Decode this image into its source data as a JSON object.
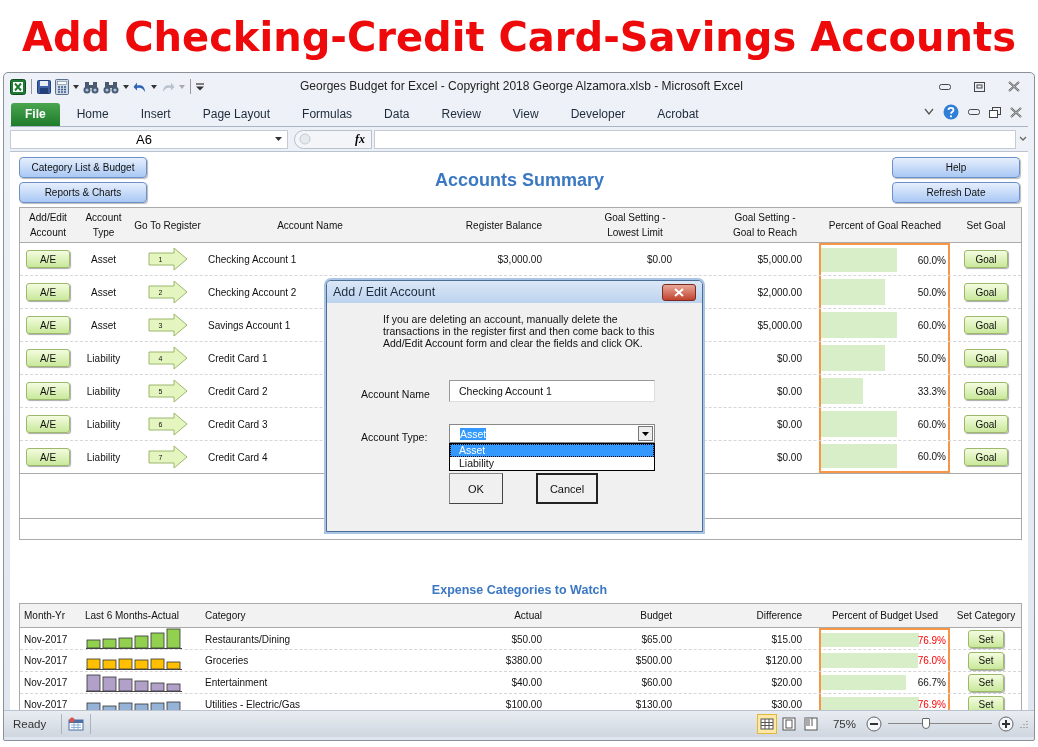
{
  "banner": {
    "title": "Add Checking-Credit Card-Savings Accounts"
  },
  "window": {
    "title": "Georges Budget for Excel - Copyright 2018 George Alzamora.xlsb  -  Microsoft Excel"
  },
  "ribbon": {
    "tabs": [
      {
        "label": "File",
        "kind": "file",
        "selected": false
      },
      {
        "label": "Home",
        "kind": "tab",
        "selected": false
      },
      {
        "label": "Insert",
        "kind": "tab",
        "selected": false
      },
      {
        "label": "Page Layout",
        "kind": "tab",
        "selected": false
      },
      {
        "label": "Formulas",
        "kind": "tab",
        "selected": false
      },
      {
        "label": "Data",
        "kind": "tab",
        "selected": false
      },
      {
        "label": "Review",
        "kind": "tab",
        "selected": false
      },
      {
        "label": "View",
        "kind": "tab",
        "selected": false
      },
      {
        "label": "Developer",
        "kind": "tab",
        "selected": false
      },
      {
        "label": "Acrobat",
        "kind": "tab",
        "selected": false
      }
    ]
  },
  "formula_bar": {
    "name_box": "A6",
    "function_label": "fx"
  },
  "sheet": {
    "left_buttons": [
      "Category List & Budget",
      "Reports & Charts"
    ],
    "title": "Accounts Summary",
    "right_buttons": [
      "Help",
      "Refresh Date"
    ],
    "accounts": {
      "columns": [
        "Add/Edit Account",
        "Account Type",
        "Go To Register",
        "Account Name",
        "Register Balance",
        "Goal Setting - Lowest Limit",
        "Goal Setting - Goal to Reach",
        "Percent of Goal Reached",
        "Set Goal"
      ],
      "rows": [
        {
          "edit_button": "A/E",
          "type": "Asset",
          "register_button": "1",
          "name": "Checking Account 1",
          "register_balance": "$3,000.00",
          "lowest_limit": "$0.00",
          "goal": "$5,000.00",
          "level": 0.6,
          "percent": "60.0%",
          "goal_button": "Goal"
        },
        {
          "edit_button": "A/E",
          "type": "Asset",
          "register_button": "2",
          "name": "Checking Account 2",
          "goal": "$2,000.00",
          "level": 0.5,
          "percent": "50.0%",
          "goal_button": "Goal"
        },
        {
          "edit_button": "A/E",
          "type": "Asset",
          "register_button": "3",
          "name": "Savings Account 1",
          "goal": "$5,000.00",
          "level": 0.6,
          "percent": "60.0%",
          "goal_button": "Goal"
        },
        {
          "edit_button": "A/E",
          "type": "Liability",
          "register_button": "4",
          "name": "Credit Card 1",
          "goal": "$0.00",
          "level": 0.5,
          "percent": "50.0%",
          "goal_button": "Goal"
        },
        {
          "edit_button": "A/E",
          "type": "Liability",
          "register_button": "5",
          "name": "Credit Card 2",
          "goal": "$0.00",
          "level": 0.333,
          "percent": "33.3%",
          "goal_button": "Goal"
        },
        {
          "edit_button": "A/E",
          "type": "Liability",
          "register_button": "6",
          "name": "Credit Card 3",
          "goal": "$0.00",
          "level": 0.6,
          "percent": "60.0%",
          "goal_button": "Goal"
        },
        {
          "edit_button": "A/E",
          "type": "Liability",
          "register_button": "7",
          "name": "Credit Card 4",
          "goal": "$0.00",
          "level": 0.6,
          "percent": "60.0%",
          "goal_button": "Goal"
        }
      ]
    },
    "expenses": {
      "title": "Expense Categories to Watch",
      "columns": [
        "Month-Yr",
        "Last 6 Months-Actual",
        "Category",
        "Actual",
        "Budget",
        "Difference",
        "Percent of Budget Used",
        "Set Category"
      ],
      "rows": [
        {
          "month": "Nov-2017",
          "color": "#92d050",
          "category": "Restaurants/Dining",
          "actual": "$50.00",
          "budget": "$65.00",
          "difference": "$15.00",
          "level": 0.769,
          "percent": "76.9%",
          "over": true,
          "button": "Set"
        },
        {
          "month": "Nov-2017",
          "color": "#ffc000",
          "category": "Groceries",
          "actual": "$380.00",
          "budget": "$500.00",
          "difference": "$120.00",
          "level": 0.76,
          "percent": "76.0%",
          "over": true,
          "button": "Set"
        },
        {
          "month": "Nov-2017",
          "color": "#b1a0c7",
          "category": "Entertainment",
          "actual": "$40.00",
          "budget": "$60.00",
          "difference": "$20.00",
          "level": 0.667,
          "percent": "66.7%",
          "over": false,
          "button": "Set"
        },
        {
          "month": "Nov-2017",
          "color": "#95b3d7",
          "category": "Utilities - Electric/Gas",
          "actual": "$100.00",
          "budget": "$130.00",
          "difference": "$30.00",
          "level": 0.769,
          "percent": "76.9%",
          "over": true,
          "button": "Set"
        }
      ]
    }
  },
  "dialog": {
    "title": "Add / Edit Account",
    "message": "If you are deleting an account, manually delete the transactions in the register first and then come back to this Add/Edit Account form and clear the fields and click OK.",
    "name_label": "Account Name",
    "name_value": "Checking Account 1",
    "type_label": "Account Type:",
    "type_value": "Asset",
    "type_highlighted": true,
    "type_options": [
      {
        "label": "Asset",
        "selected": true
      },
      {
        "label": "Liability",
        "selected": false
      }
    ],
    "buttons": [
      "OK",
      "Cancel"
    ]
  },
  "status_bar": {
    "status": "Ready",
    "views": [
      {
        "kind": "normal",
        "selected": true
      },
      {
        "kind": "page_layout",
        "selected": false
      },
      {
        "kind": "page_break",
        "selected": false
      }
    ],
    "zoom": "75%",
    "zoom_slider": {
      "level": 0.37
    }
  }
}
